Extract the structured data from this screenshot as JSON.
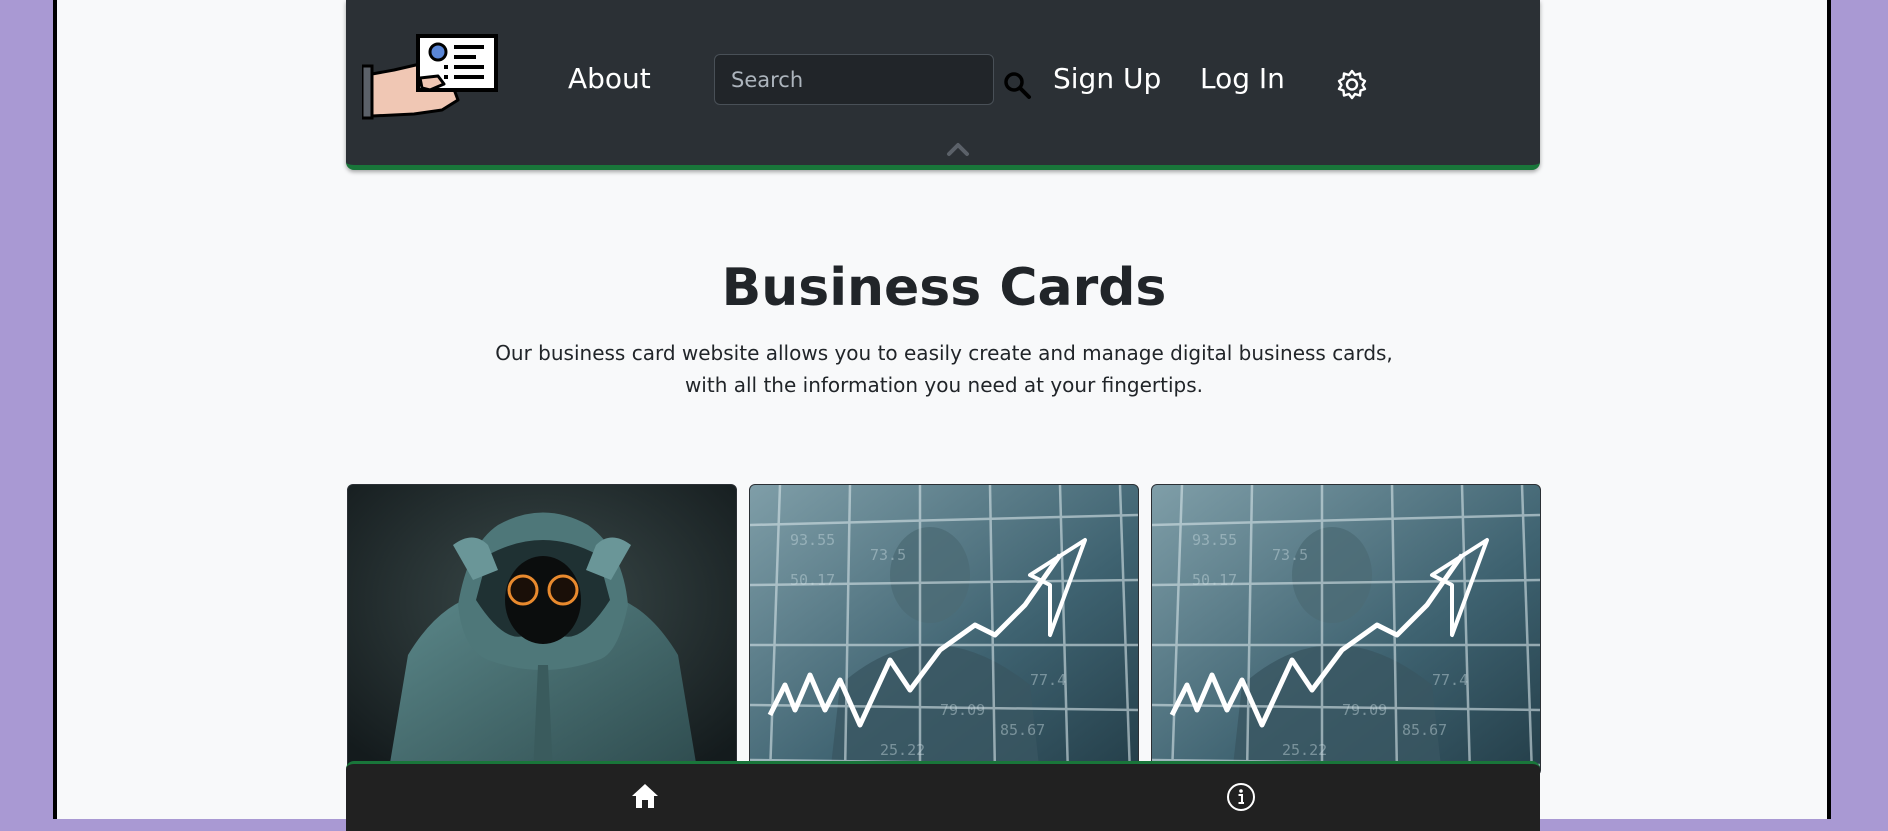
{
  "navbar": {
    "logo_icon": "business-card-hand-icon",
    "about_label": "About",
    "search_placeholder": "Search",
    "search_icon": "search-icon",
    "signup_label": "Sign Up",
    "login_label": "Log In",
    "settings_icon": "gear-icon",
    "collapse_icon": "chevron-up-icon"
  },
  "hero": {
    "title": "Business Cards",
    "subtitle_line1": "Our business card website allows you to easily create and manage digital business cards,",
    "subtitle_line2": "with all the information you need at your fingertips."
  },
  "cards": [
    {
      "image": "hooded-figure-with-glowing-eyes"
    },
    {
      "image": "stock-chart-rising-arrow"
    },
    {
      "image": "stock-chart-rising-arrow"
    }
  ],
  "footer": {
    "home_icon": "home-icon",
    "info_icon": "info-icon"
  },
  "colors": {
    "page_background": "#a999d3",
    "content_background": "#f8f9fa",
    "navbar_background": "#2b3035",
    "accent_green": "#19763a",
    "footer_background": "#212121"
  }
}
